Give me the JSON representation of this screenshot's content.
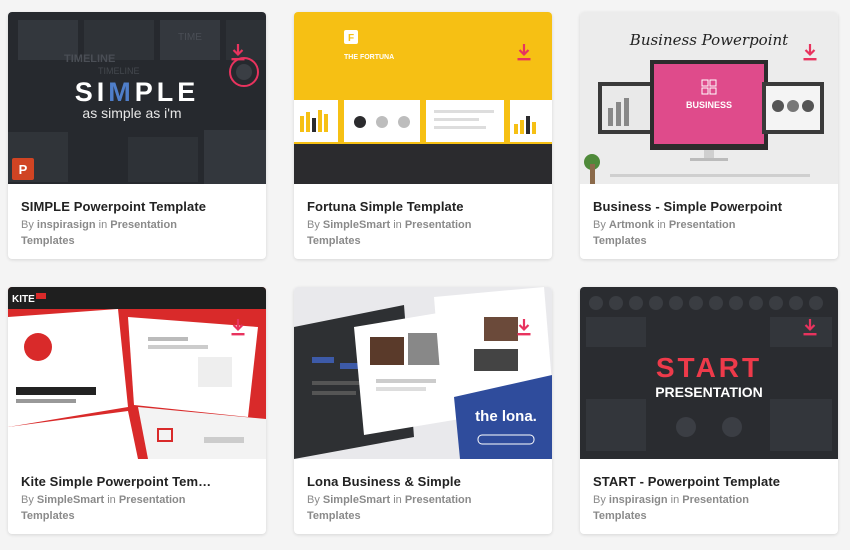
{
  "colors": {
    "accent": "#e8335e",
    "title_text": "#222222",
    "meta_text": "#8a8a8a",
    "card_bg": "#ffffff",
    "page_bg": "#f4f4f4"
  },
  "icons": {
    "download": "download-icon"
  },
  "cards": [
    {
      "title": "SIMPLE Powerpoint Template",
      "author": "inspirasign",
      "in_word": "in",
      "category": "Presentation Templates",
      "by_word": "By",
      "thumb": {
        "headline_a": "SI",
        "headline_b": "M",
        "headline_c": "PLE",
        "tagline": "as simple as i'm",
        "bg_word_1": "TIMELINE",
        "bg_word_2": "TIMELINE",
        "bg_word_3": "TIME",
        "app_badge": "P"
      }
    },
    {
      "title": "Fortuna Simple Template",
      "author": "SimpleSmart",
      "in_word": "in",
      "category": "Presentation Templates",
      "by_word": "By",
      "thumb": {
        "brand": "THE FORTUNA",
        "logo_letter": "F"
      }
    },
    {
      "title": "Business - Simple Powerpoint",
      "author": "Artmonk",
      "in_word": "in",
      "category": "Presentation Templates",
      "by_word": "By",
      "thumb": {
        "script_title": "Business Powerpoint",
        "screen_label": "BUSINESS"
      }
    },
    {
      "title": "Kite Simple Powerpoint Templ...",
      "author": "SimpleSmart",
      "in_word": "in",
      "category": "Presentation Templates",
      "by_word": "By",
      "thumb": {
        "brand": "KITE"
      }
    },
    {
      "title": "Lona Business & Simple",
      "author": "SimpleSmart",
      "in_word": "in",
      "category": "Presentation Templates",
      "by_word": "By",
      "thumb": {
        "brand": "the lona."
      }
    },
    {
      "title": "START - Powerpoint Template",
      "author": "inspirasign",
      "in_word": "in",
      "category": "Presentation Templates",
      "by_word": "By",
      "thumb": {
        "headline": "START",
        "subline": "PRESENTATION"
      }
    }
  ]
}
